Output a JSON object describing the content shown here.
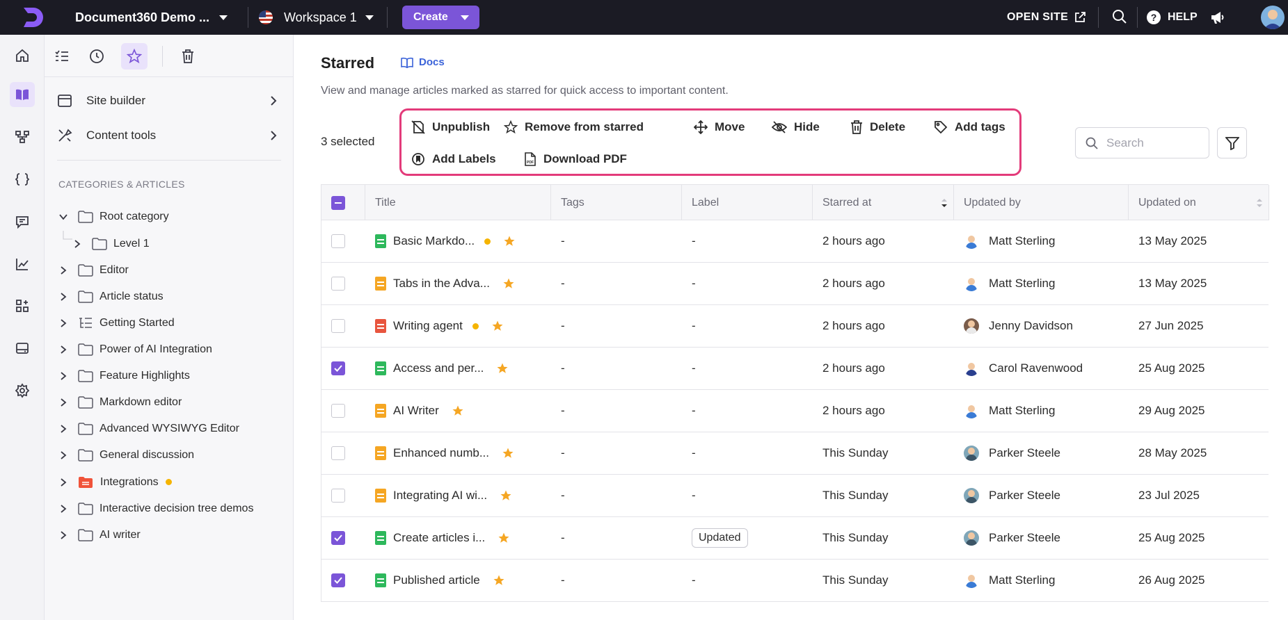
{
  "topbar": {
    "project_name": "Document360 Demo ...",
    "workspace": "Workspace 1",
    "create_label": "Create",
    "open_site_label": "OPEN SITE",
    "help_label": "HELP",
    "help_glyph": "?",
    "icons": [
      "logo-icon",
      "flag-icon",
      "external-link-icon",
      "search-icon",
      "help-icon",
      "megaphone-icon"
    ]
  },
  "rail": {
    "items": [
      "home-icon",
      "book-icon",
      "hierarchy-icon",
      "api-icon",
      "feedback-icon",
      "analytics-icon",
      "widgets-icon",
      "drive-icon",
      "settings-icon"
    ],
    "active": "book-icon"
  },
  "sidebar": {
    "tools": [
      "tasks-icon",
      "clock-icon",
      "star-icon",
      "trash-icon"
    ],
    "active_tool": "star-icon",
    "links": [
      {
        "label": "Site builder"
      },
      {
        "label": "Content tools"
      }
    ],
    "section_title": "CATEGORIES & ARTICLES",
    "tree": [
      {
        "label": "Root category",
        "expanded": true
      },
      {
        "label": "Level 1"
      },
      {
        "label": "Editor"
      },
      {
        "label": "Article status"
      },
      {
        "label": "Getting Started"
      },
      {
        "label": "Power of AI Integration"
      },
      {
        "label": "Feature Highlights"
      },
      {
        "label": "Markdown editor"
      },
      {
        "label": "Advanced WYSIWYG Editor"
      },
      {
        "label": "General discussion"
      },
      {
        "label": "Integrations",
        "status_dot": true
      },
      {
        "label": "Interactive decision tree demos"
      },
      {
        "label": "AI writer"
      }
    ]
  },
  "main": {
    "title": "Starred",
    "docs_label": "Docs",
    "subtitle": "View and manage articles marked as starred for quick access to important content.",
    "selected_text": "3 selected",
    "actions": [
      {
        "label": "Unpublish",
        "icon": "unpublish-icon"
      },
      {
        "label": "Remove from starred",
        "icon": "star-outline-icon"
      },
      {
        "label": "Move",
        "icon": "move-icon"
      },
      {
        "label": "Hide",
        "icon": "eye-off-icon"
      },
      {
        "label": "Delete",
        "icon": "trash-icon"
      },
      {
        "label": "Add tags",
        "icon": "tag-icon"
      },
      {
        "label": "Add Labels",
        "icon": "label-icon"
      },
      {
        "label": "Download PDF",
        "icon": "pdf-icon"
      }
    ],
    "search": {
      "placeholder": "Search",
      "value": ""
    },
    "filter_icon": "filter-icon"
  },
  "table": {
    "columns": [
      "Title",
      "Tags",
      "Label",
      "Starred at",
      "Updated by",
      "Updated on"
    ],
    "header_checkbox": "indeterminate",
    "rows": [
      {
        "checked": false,
        "title": "Basic Markdo...",
        "doc_color": "#2eb85c",
        "dot": true,
        "tags": "-",
        "label": "-",
        "starred_at": "2 hours ago",
        "updated_by": "Matt Sterling",
        "avatar": "av-a",
        "updated_on": "13 May 2025"
      },
      {
        "checked": false,
        "title": "Tabs in the Adva...",
        "doc_color": "#f5a623",
        "dot": false,
        "tags": "-",
        "label": "-",
        "starred_at": "2 hours ago",
        "updated_by": "Matt Sterling",
        "avatar": "av-a",
        "updated_on": "13 May 2025"
      },
      {
        "checked": false,
        "title": "Writing agent",
        "doc_color": "#e8553e",
        "dot": true,
        "tags": "-",
        "label": "-",
        "starred_at": "2 hours ago",
        "updated_by": "Jenny Davidson",
        "avatar": "av-b",
        "updated_on": "27 Jun 2025"
      },
      {
        "checked": true,
        "title": "Access and per...",
        "doc_color": "#2eb85c",
        "dot": false,
        "tags": "-",
        "label": "-",
        "starred_at": "2 hours ago",
        "updated_by": "Carol Ravenwood",
        "avatar": "av-c",
        "updated_on": "25 Aug 2025"
      },
      {
        "checked": false,
        "title": "AI Writer",
        "doc_color": "#f5a623",
        "dot": false,
        "tags": "-",
        "label": "-",
        "starred_at": "2 hours ago",
        "updated_by": "Matt Sterling",
        "avatar": "av-a",
        "updated_on": "29 Aug 2025"
      },
      {
        "checked": false,
        "title": "Enhanced numb...",
        "doc_color": "#f5a623",
        "dot": false,
        "tags": "-",
        "label": "-",
        "starred_at": "This Sunday",
        "updated_by": "Parker Steele",
        "avatar": "av-d",
        "updated_on": "28 May 2025"
      },
      {
        "checked": false,
        "title": "Integrating AI wi...",
        "doc_color": "#f5a623",
        "dot": false,
        "tags": "-",
        "label": "-",
        "starred_at": "This Sunday",
        "updated_by": "Parker Steele",
        "avatar": "av-d",
        "updated_on": "23 Jul 2025"
      },
      {
        "checked": true,
        "title": "Create articles i...",
        "doc_color": "#2eb85c",
        "dot": false,
        "tags": "-",
        "label": "Updated",
        "starred_at": "This Sunday",
        "updated_by": "Parker Steele",
        "avatar": "av-d",
        "updated_on": "25 Aug 2025"
      },
      {
        "checked": true,
        "title": "Published article",
        "doc_color": "#2eb85c",
        "dot": false,
        "tags": "-",
        "label": "-",
        "starred_at": "This Sunday",
        "updated_by": "Matt Sterling",
        "avatar": "av-a",
        "updated_on": "26 Aug 2025"
      }
    ]
  },
  "colors": {
    "accent": "#7b55d8",
    "highlight": "#e33b7a",
    "star": "#f5a623",
    "topbar": "#1b1b24"
  }
}
